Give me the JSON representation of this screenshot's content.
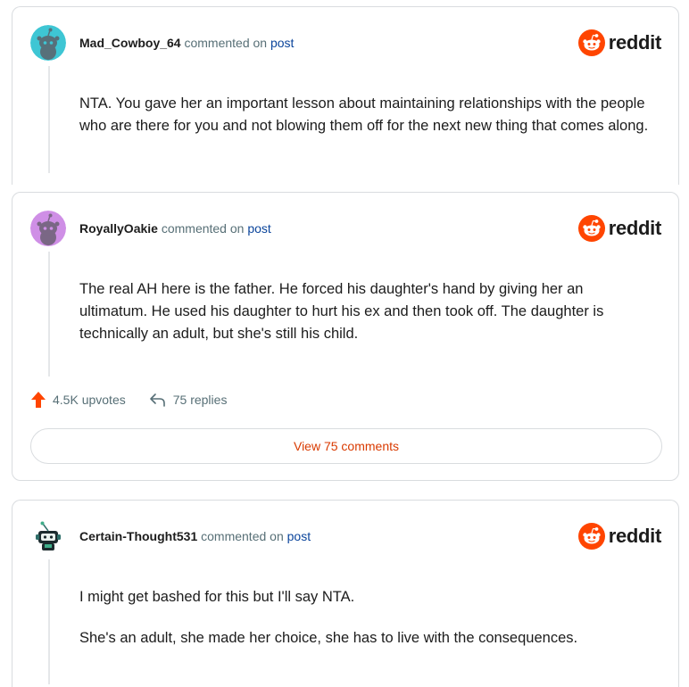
{
  "colors": {
    "reddit_orange": "#ff4500",
    "link_blue": "#0a449b",
    "action_orange": "#d93a00",
    "upvote_red": "#ff4500"
  },
  "brand": {
    "logo_icon": "reddit-snoo-icon",
    "logo_word": "reddit"
  },
  "comments": [
    {
      "username": "Mad_Cowboy_64",
      "commented_on": "commented on",
      "post_link": "post",
      "avatar_color": "#3ec6d4",
      "avatar_icon": "snoo-avatar-icon",
      "body": [
        "NTA. You gave her an important lesson about maintaining relationships with the people who are there for you and not blowing them off for the next new thing that comes along."
      ]
    },
    {
      "username": "RoyallyOakie",
      "commented_on": "commented on",
      "post_link": "post",
      "avatar_color": "#cf8fe6",
      "avatar_icon": "snoo-avatar-icon",
      "body": [
        "The real AH here is the father. He forced his daughter's hand by giving her an ultimatum. He used his daughter to hurt his ex and then took off. The daughter is technically an adult, but she's still his child."
      ],
      "upvotes": "4.5K upvotes",
      "replies": "75 replies",
      "view_comments": "View 75 comments",
      "upvote_icon": "upvote-arrow-icon",
      "reply_icon": "reply-arrow-icon"
    },
    {
      "username": "Certain-Thought531",
      "commented_on": "commented on",
      "post_link": "post",
      "avatar_color": "#ffffff",
      "avatar_icon": "custom-snoo-avatar-icon",
      "body": [
        "I might get bashed for this but I'll say NTA.",
        "She's an adult, she made her choice, she has to live with the consequences."
      ]
    }
  ]
}
